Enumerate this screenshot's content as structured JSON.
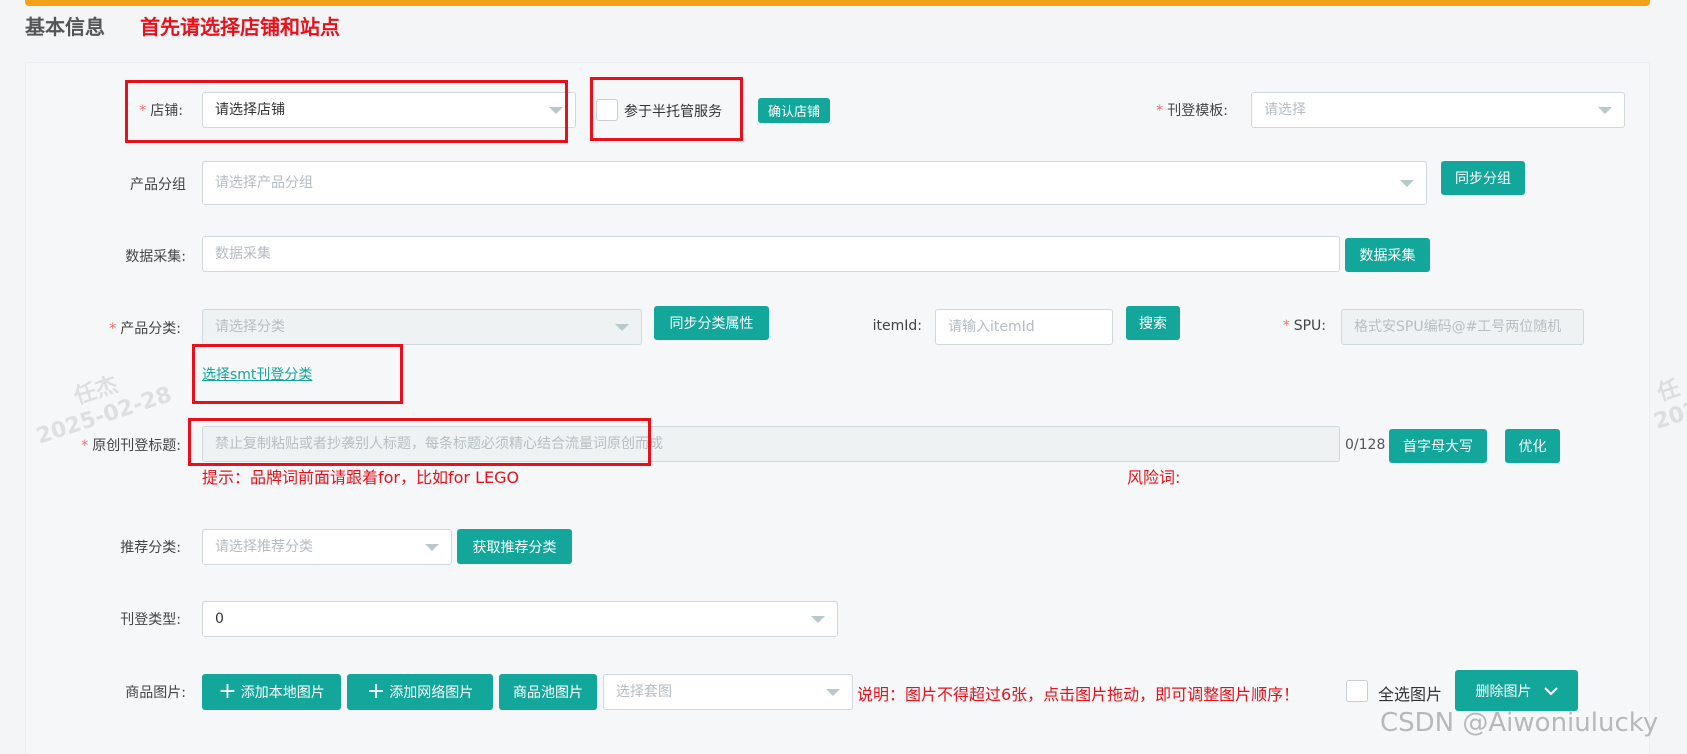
{
  "header": {
    "title": "基本信息",
    "notice": "首先请选择店铺和站点"
  },
  "form": {
    "store": {
      "label": "店铺:",
      "value": "请选择店铺"
    },
    "semi_managed": {
      "label": "参于半托管服务"
    },
    "confirm_store_button": "确认店铺",
    "template": {
      "label": "刊登模板:",
      "placeholder": "请选择"
    },
    "product_group": {
      "label": "产品分组",
      "placeholder": "请选择产品分组",
      "sync_button": "同步分组"
    },
    "data_collect": {
      "label": "数据采集:",
      "placeholder": "数据采集",
      "button": "数据采集"
    },
    "category": {
      "label": "产品分类:",
      "placeholder": "请选择分类",
      "sync_button": "同步分类属性",
      "smt_link": "选择smt刊登分类"
    },
    "item_id": {
      "label": "itemId:",
      "placeholder": "请输入itemId",
      "search_button": "搜索"
    },
    "spu": {
      "label": "SPU:",
      "placeholder": "格式安SPU编码@#工号两位随机"
    },
    "title": {
      "label": "原创刊登标题:",
      "placeholder": "禁止复制粘贴或者抄袭别人标题，每条标题必须精心结合流量词原创而成",
      "counter": "0/128",
      "capitalize_button": "首字母大写",
      "optimize_button": "优化",
      "hint": "提示：品牌词前面请跟着for，比如for LEGO",
      "risk_label": "风险词:"
    },
    "recommend": {
      "label": "推荐分类:",
      "placeholder": "请选择推荐分类",
      "button": "获取推荐分类"
    },
    "listing_type": {
      "label": "刊登类型:",
      "value": "0"
    },
    "images": {
      "label": "商品图片:",
      "add_local_button": "添加本地图片",
      "add_web_button": "添加网络图片",
      "pool_button": "商品池图片",
      "set_placeholder": "选择套图",
      "note": "说明：图片不得超过6张，点击图片拖动，即可调整图片顺序！",
      "select_all_label": "全选图片",
      "delete_button": "删除图片"
    }
  },
  "watermark": {
    "name": "任杰",
    "date": "2025-02-28",
    "right_name": "任",
    "right_date": "202"
  },
  "csdn_watermark": "CSDN @Aiwoniulucky",
  "colors": {
    "accent": "#13a79b",
    "warning": "#e8111b",
    "topbar": "#f5a019"
  }
}
